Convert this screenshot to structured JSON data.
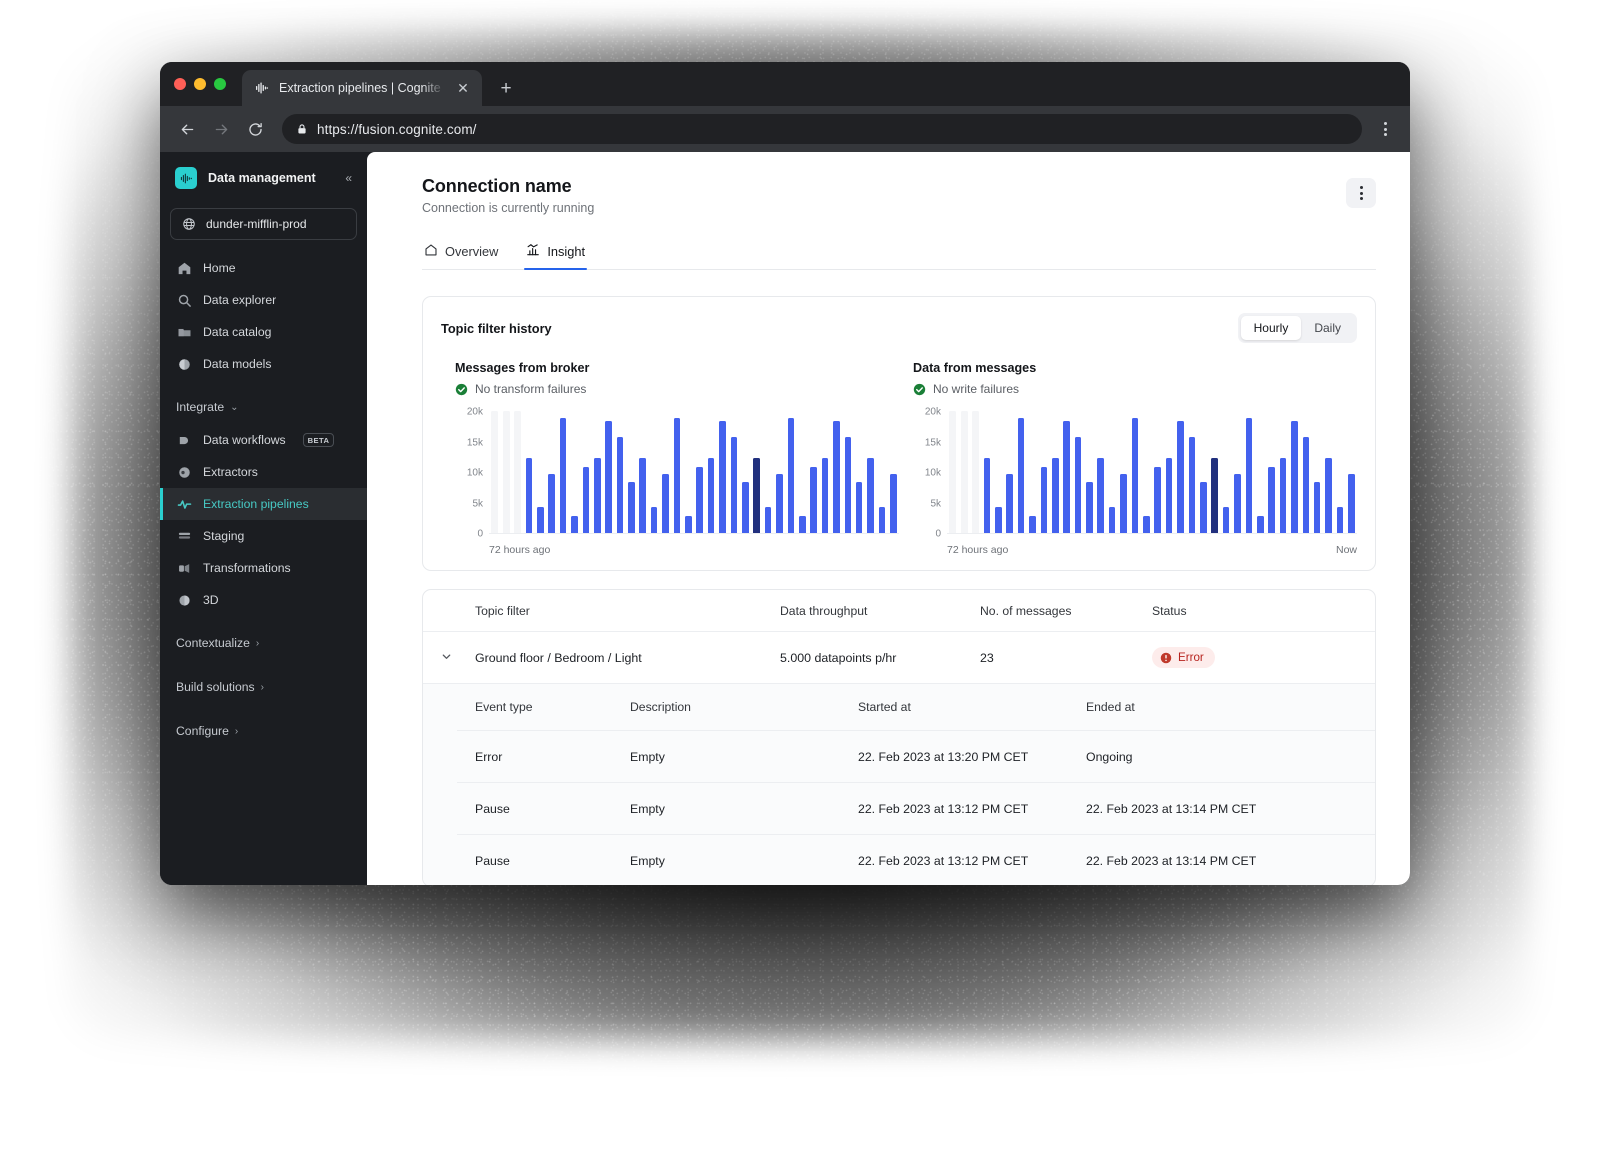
{
  "browser": {
    "tab": {
      "title": "Extraction pipelines | Cognite D",
      "favicon_icon": "cognite-logo-icon",
      "close_icon": "close-icon"
    },
    "new_tab_label": "+",
    "back_icon": "arrow-left-icon",
    "forward_icon": "arrow-right-icon",
    "reload_icon": "reload-icon",
    "lock_icon": "lock-icon",
    "url": "https://fusion.cognite.com/",
    "menu_icon": "browser-menu-icon"
  },
  "sidebar": {
    "brand": "Data management",
    "brand_logo_icon": "cognite-logo-icon",
    "collapse_icon": "chevron-double-left-icon",
    "collapse_label": "«",
    "project": {
      "label": "dunder-mifflin-prod",
      "icon": "globe-icon"
    },
    "items": [
      {
        "label": "Home",
        "icon": "home-icon",
        "active": false
      },
      {
        "label": "Data explorer",
        "icon": "search-icon",
        "active": false
      },
      {
        "label": "Data catalog",
        "icon": "folder-icon",
        "active": false
      },
      {
        "label": "Data models",
        "icon": "sphere-icon",
        "active": false
      }
    ],
    "integrate_group": {
      "label": "Integrate",
      "caret": "⌄"
    },
    "integrate_items": [
      {
        "label": "Data workflows",
        "icon": "workflow-icon",
        "badge": "BETA",
        "active": false
      },
      {
        "label": "Extractors",
        "icon": "extractor-icon",
        "active": false
      },
      {
        "label": "Extraction pipelines",
        "icon": "pipeline-icon",
        "active": true
      },
      {
        "label": "Staging",
        "icon": "staging-icon",
        "active": false
      },
      {
        "label": "Transformations",
        "icon": "transform-icon",
        "active": false
      },
      {
        "label": "3D",
        "icon": "cube-icon",
        "active": false
      }
    ],
    "groups": [
      {
        "label": "Contextualize",
        "caret": "›"
      },
      {
        "label": "Build solutions",
        "caret": "›"
      },
      {
        "label": "Configure",
        "caret": "›"
      }
    ]
  },
  "header": {
    "title": "Connection name",
    "subtitle": "Connection is currently running",
    "menu_icon": "kebab-menu-icon"
  },
  "tabs": [
    {
      "label": "Overview",
      "icon": "home-icon",
      "active": false
    },
    {
      "label": "Insight",
      "icon": "bar-chart-icon",
      "active": true
    }
  ],
  "card": {
    "title": "Topic filter history",
    "range_options": [
      {
        "label": "Hourly",
        "active": true
      },
      {
        "label": "Daily",
        "active": false
      }
    ]
  },
  "chart_data": [
    {
      "type": "bar",
      "title": "Messages from broker",
      "status_text": "No transform failures",
      "status_icon": "check-circle-icon",
      "xlabel": "",
      "ylabel": "",
      "ylim": [
        0,
        20000
      ],
      "yticks": [
        20000,
        15000,
        10000,
        5000,
        0
      ],
      "ytick_labels": [
        "20k",
        "15k",
        "10k",
        "5k",
        "0"
      ],
      "x_start_label": "72 hours ago",
      "x_end_label": "",
      "grid": false,
      "bar_color": "#4361ee",
      "highlight_color": "#21307e",
      "blank_color": "#f4f5f7",
      "values": [
        null,
        null,
        null,
        12300,
        4300,
        9600,
        18900,
        2800,
        10900,
        12300,
        18400,
        15700,
        8400,
        12300,
        4300,
        9600,
        18900,
        2800,
        10900,
        12300,
        18400,
        15700,
        8400,
        12300,
        4300,
        9600,
        18900,
        2800,
        10900,
        12300,
        18400,
        15700,
        8400,
        12300,
        4300,
        9600
      ],
      "highlight_index": 23
    },
    {
      "type": "bar",
      "title": "Data from messages",
      "status_text": "No write failures",
      "status_icon": "check-circle-icon",
      "xlabel": "",
      "ylabel": "",
      "ylim": [
        0,
        20000
      ],
      "yticks": [
        20000,
        15000,
        10000,
        5000,
        0
      ],
      "ytick_labels": [
        "20k",
        "15k",
        "10k",
        "5k",
        "0"
      ],
      "x_start_label": "72 hours ago",
      "x_end_label": "Now",
      "grid": false,
      "bar_color": "#4361ee",
      "highlight_color": "#21307e",
      "blank_color": "#f4f5f7",
      "values": [
        null,
        null,
        null,
        12300,
        4300,
        9600,
        18900,
        2800,
        10900,
        12300,
        18400,
        15700,
        8400,
        12300,
        4300,
        9600,
        18900,
        2800,
        10900,
        12300,
        18400,
        15700,
        8400,
        12300,
        4300,
        9600,
        18900,
        2800,
        10900,
        12300,
        18400,
        15700,
        8400,
        12300,
        4300,
        9600
      ],
      "highlight_index": 23
    }
  ],
  "table": {
    "columns": [
      "Topic filter",
      "Data throughput",
      "No. of messages",
      "Status"
    ],
    "expand_icon": "chevron-down-icon",
    "row": {
      "topic_filter": "Ground floor / Bedroom / Light",
      "throughput": "5.000 datapoints p/hr",
      "messages": "23",
      "status": "Error",
      "status_icon": "error-icon"
    },
    "sub_columns": [
      "Event type",
      "Description",
      "Started at",
      "Ended at"
    ],
    "sub_rows": [
      {
        "event_type": "Error",
        "description": "Empty",
        "started_at": "22. Feb 2023 at 13:20 PM CET",
        "ended_at": "Ongoing"
      },
      {
        "event_type": "Pause",
        "description": "Empty",
        "started_at": "22. Feb 2023 at 13:12 PM CET",
        "ended_at": "22. Feb 2023 at 13:14 PM CET"
      },
      {
        "event_type": "Pause",
        "description": "Empty",
        "started_at": "22. Feb 2023 at 13:12 PM CET",
        "ended_at": "22. Feb 2023 at 13:14 PM CET"
      }
    ]
  },
  "colors": {
    "accent_teal": "#2acfcf",
    "accent_blue": "#2563eb",
    "bar_blue": "#4361ee",
    "bar_dark": "#21307e",
    "error_red": "#b7241f",
    "error_bg": "#fdeceb",
    "success_green": "#1a7f37",
    "sidebar_bg": "#1b1d21"
  }
}
